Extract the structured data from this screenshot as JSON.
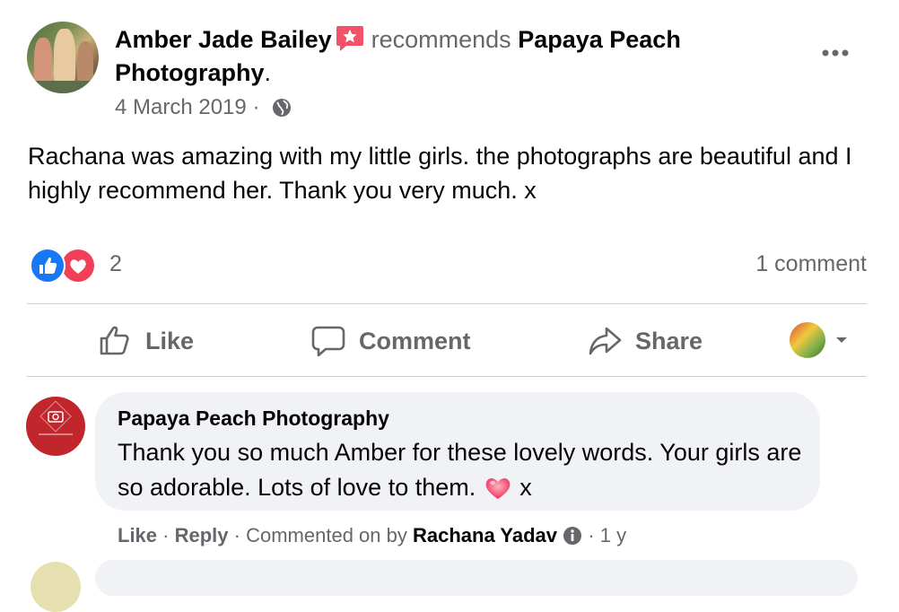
{
  "post": {
    "author": "Amber Jade Bailey",
    "recommends_word": "recommends",
    "page_name": "Papaya Peach Photography",
    "period": ".",
    "date": "4 March 2019",
    "date_separator": "·",
    "body": "Rachana was amazing with my little girls. the photographs are beautiful and I highly recommend her. Thank you very much. x",
    "reaction_count": "2",
    "comment_count": "1 comment",
    "reaction_types": [
      "like-icon",
      "love-icon"
    ]
  },
  "actions": {
    "like": "Like",
    "comment": "Comment",
    "share": "Share"
  },
  "comment": {
    "author": "Papaya Peach Photography",
    "text_before_emoji": "Thank you so much Amber for these lovely words. Your girls are so adorable. Lots of love to them.",
    "emoji": "heart-emoji",
    "text_after_emoji": " x",
    "meta": {
      "like": "Like",
      "dot1": "·",
      "reply": "Reply",
      "dot2": "·",
      "commented_on_by": "Commented on by",
      "responder": "Rachana Yadav",
      "dot3": "·",
      "age": "1 y"
    }
  },
  "colors": {
    "like_blue": "#1877f2",
    "love_red": "#f33e58",
    "muted_text": "#65676b",
    "bubble_bg": "#f0f2f5",
    "recommend_badge": "#f25268",
    "page_avatar_red": "#c0262c"
  }
}
